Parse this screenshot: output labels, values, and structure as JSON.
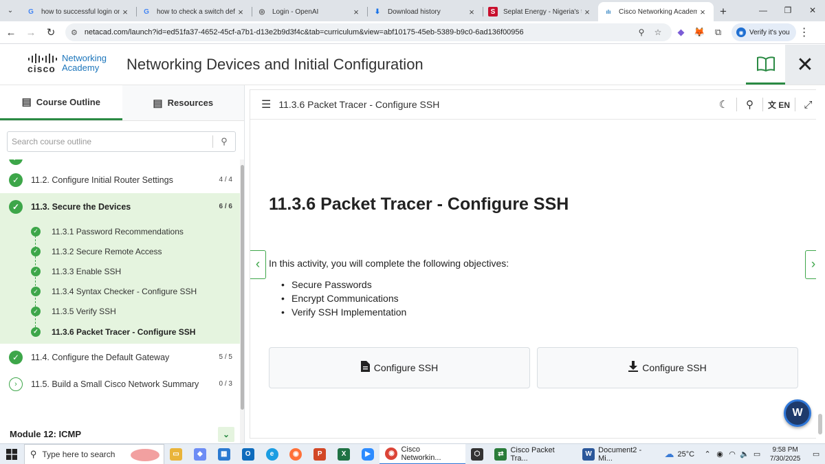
{
  "browser": {
    "tabs": [
      {
        "title": "how to successful login on c",
        "favicon": "google-g-icon",
        "color": "#4285f4",
        "glyph": "G"
      },
      {
        "title": "how to check a switch default",
        "favicon": "google-g-icon",
        "color": "#4285f4",
        "glyph": "G"
      },
      {
        "title": "Login - OpenAI",
        "favicon": "openai-icon",
        "color": "#555555",
        "glyph": "◎"
      },
      {
        "title": "Download history",
        "favicon": "download-icon",
        "color": "#1a73e8",
        "glyph": "⬇"
      },
      {
        "title": "Seplat Energy - Nigeria's tru",
        "favicon": "seplat-s-icon",
        "color": "#c8102e",
        "glyph": "S"
      },
      {
        "title": "Cisco Networking Academy",
        "favicon": "cisco-icon",
        "color": "#1b75bb",
        "glyph": "ılı",
        "active": true
      }
    ],
    "url": "netacad.com/launch?id=ed51fa37-4652-45cf-a7b1-d13e2b9d3f4c&tab=curriculum&view=abf10175-45eb-5389-b9c0-6ad136f00956",
    "verify_label": "Verify it's you"
  },
  "header": {
    "logo_line1": "Networking",
    "logo_line2": "Academy",
    "logo_brand": "cisco",
    "course_title": "Networking Devices and Initial Configuration"
  },
  "sidebar": {
    "tab_outline": "Course Outline",
    "tab_resources": "Resources",
    "search_placeholder": "Search course outline",
    "topics": [
      {
        "label": "11.2. Configure Initial Router Settings",
        "count": "4 / 4",
        "status": "complete"
      },
      {
        "label": "11.3. Secure the Devices",
        "count": "6 / 6",
        "status": "complete",
        "selected": true
      },
      {
        "label": "11.4. Configure the Default Gateway",
        "count": "5 / 5",
        "status": "complete"
      },
      {
        "label": "11.5. Build a Small Cisco Network Summary",
        "count": "0 / 3",
        "status": "incomplete"
      }
    ],
    "subtopics": [
      {
        "label": "11.3.1 Password Recommendations"
      },
      {
        "label": "11.3.2 Secure Remote Access"
      },
      {
        "label": "11.3.3 Enable SSH"
      },
      {
        "label": "11.3.4 Syntax Checker - Configure SSH"
      },
      {
        "label": "11.3.5 Verify SSH"
      },
      {
        "label": "11.3.6 Packet Tracer - Configure SSH",
        "selected": true
      }
    ],
    "module": "Module 12: ICMP"
  },
  "content": {
    "toolbar_title": "11.3.6 Packet Tracer - Configure SSH",
    "lang": "EN",
    "title": "11.3.6 Packet Tracer - Configure SSH",
    "intro": "In this activity, you will complete the following objectives:",
    "objectives": [
      "Secure Passwords",
      "Encrypt Communications",
      "Verify SSH Implementation"
    ],
    "buttons": [
      {
        "label": "Configure SSH",
        "icon": "document-icon"
      },
      {
        "label": "Configure SSH",
        "icon": "download-icon"
      }
    ]
  },
  "taskbar": {
    "search_placeholder": "Type here to search",
    "windows": [
      {
        "label": "Cisco Networkin...",
        "icon": "chrome-icon"
      },
      {
        "label": "Cisco Packet Tra...",
        "icon": "packet-tracer-icon"
      },
      {
        "label": "Document2 - Mi...",
        "icon": "word-icon"
      }
    ],
    "weather": "25°C",
    "time": "9:58 PM",
    "date": "7/30/2025"
  },
  "colors": {
    "accent_green": "#3da649",
    "selected_bg": "#e5f4df",
    "cisco_blue": "#1b75bb"
  }
}
